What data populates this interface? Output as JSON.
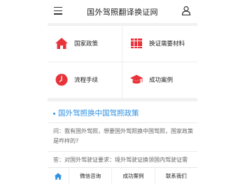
{
  "header": {
    "title": "国外驾照翻译换证网",
    "menu_icon": "menu-icon",
    "user_icon": "user-icon"
  },
  "grid": {
    "items": [
      {
        "label": "国家政策",
        "icon": "home-icon",
        "color": "#e8333a"
      },
      {
        "label": "换证需要材料",
        "icon": "books-icon",
        "color": "#e8333a"
      },
      {
        "label": "流程手续",
        "icon": "clock-icon",
        "color": "#e8333a"
      },
      {
        "label": "成功案例",
        "icon": "graduation-cap-icon",
        "color": "#e8333a"
      }
    ]
  },
  "article": {
    "title": "国外驾照换中国驾照政策",
    "q1": "问：我有国外驾照，想要国外驾照换中国驾照，国家政策是咋样的?",
    "a1": "答：对国外驾驶证要求：境外驾驶证换领国内驾驶证需"
  },
  "bottom_nav": {
    "home_icon": "home-icon",
    "items": [
      "微信咨询",
      "成功案例",
      "联系我们"
    ]
  },
  "colors": {
    "accent": "#2e8fe0",
    "icon_red": "#e8333a"
  }
}
